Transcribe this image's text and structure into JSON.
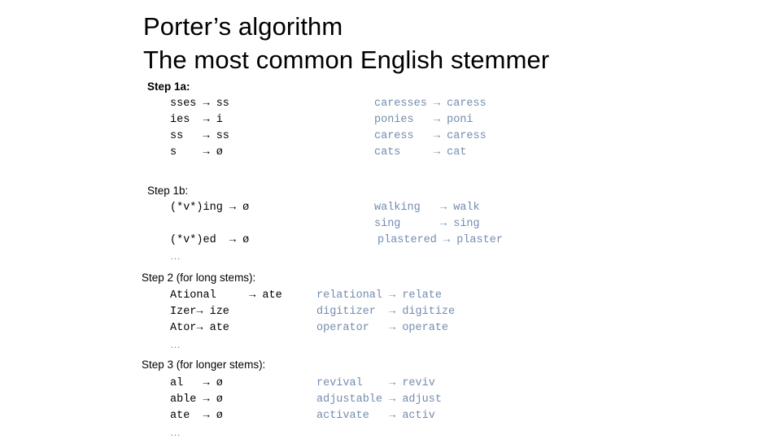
{
  "slide": {
    "title_lines": [
      "Porter’s algorithm",
      "The most common English stemmer"
    ],
    "colors": {
      "background": "#ffffff",
      "text": "#000000",
      "example_text": "#738cae"
    },
    "arrow_glyph": "→",
    "empty_string_glyph": "ø",
    "ellipsis_glyph": "…"
  },
  "sections": [
    {
      "heading": "Step 1a:",
      "heading_bold": true,
      "rules": [
        "sses → ss",
        "ies  → i",
        "ss   → ss",
        "s    → ø"
      ],
      "examples": [
        "caresses → caress",
        "ponies   → poni",
        "caress   → caress",
        "cats     → cat"
      ],
      "trailing_ellipsis": false
    },
    {
      "heading": "Step 1b:",
      "heading_bold": false,
      "rules": [
        "(*v*)ing → ø",
        "(*v*)ed  → ø"
      ],
      "examples": [
        "walking   → walk",
        "sing      → sing",
        "plastered → plaster"
      ],
      "trailing_ellipsis": true
    },
    {
      "heading": "Step 2 (for long stems):",
      "heading_bold": false,
      "rules": [
        "Ational     → ate",
        "Izer→ ize",
        "Ator→ ate"
      ],
      "examples": [
        "relational → relate",
        "digitizer  → digitize",
        "operator   → operate"
      ],
      "trailing_ellipsis": true
    },
    {
      "heading": "Step 3 (for longer stems):",
      "heading_bold": false,
      "rules": [
        "al   → ø",
        "able → ø",
        "ate  → ø"
      ],
      "examples": [
        "revival    → reviv",
        "adjustable → adjust",
        "activate   → activ"
      ],
      "trailing_ellipsis": true
    }
  ]
}
